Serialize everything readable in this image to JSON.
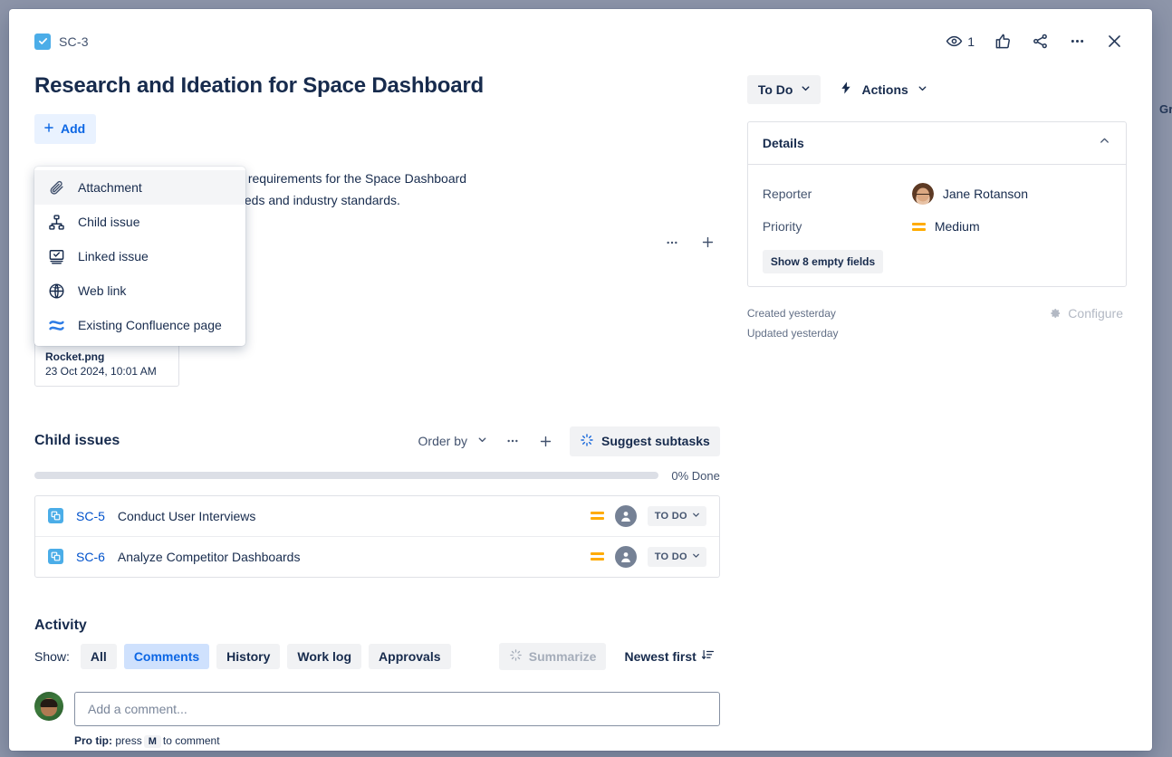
{
  "backdrop": {
    "edge_text": "Gr"
  },
  "header": {
    "issue_key": "SC-3",
    "type_icon": "task-check-icon",
    "watch_count": "1",
    "icons": [
      "eye-icon",
      "like-icon",
      "share-icon",
      "more-icon",
      "close-icon"
    ]
  },
  "issue": {
    "title": "Research and Ideation for Space Dashboard",
    "add_label": "Add",
    "description_line1": "gather inspiration and understand the requirements for the Space Dashboard",
    "description_line2": "that the wireframes align with user needs and industry standards."
  },
  "add_menu": {
    "items": [
      {
        "label": "Attachment",
        "icon": "paperclip-icon",
        "selected": true
      },
      {
        "label": "Child issue",
        "icon": "hierarchy-icon",
        "selected": false
      },
      {
        "label": "Linked issue",
        "icon": "linked-issue-icon",
        "selected": false
      },
      {
        "label": "Web link",
        "icon": "globe-icon",
        "selected": false
      },
      {
        "label": "Existing Confluence page",
        "icon": "confluence-icon",
        "selected": false
      }
    ]
  },
  "attachments": {
    "items": [
      {
        "name": "Rocket.png",
        "date": "23 Oct 2024, 10:01 AM",
        "thumb": "rocket-image"
      }
    ]
  },
  "child_issues": {
    "title": "Child issues",
    "order_by_label": "Order by",
    "suggest_label": "Suggest subtasks",
    "progress_percent": 0,
    "progress_label": "0% Done",
    "rows": [
      {
        "key": "SC-5",
        "summary": "Conduct User Interviews",
        "priority": "Medium",
        "status": "TO DO"
      },
      {
        "key": "SC-6",
        "summary": "Analyze Competitor Dashboards",
        "priority": "Medium",
        "status": "TO DO"
      }
    ]
  },
  "activity": {
    "title": "Activity",
    "show_label": "Show:",
    "filters": [
      {
        "label": "All",
        "selected": false
      },
      {
        "label": "Comments",
        "selected": true
      },
      {
        "label": "History",
        "selected": false
      },
      {
        "label": "Work log",
        "selected": false
      },
      {
        "label": "Approvals",
        "selected": false
      }
    ],
    "summarize_label": "Summarize",
    "sort_label": "Newest first",
    "comment_placeholder": "Add a comment...",
    "protip_bold": "Pro tip:",
    "protip_pre": "press",
    "protip_key": "M",
    "protip_post": "to comment"
  },
  "sidebar": {
    "status": "To Do",
    "actions_label": "Actions",
    "details_title": "Details",
    "fields": [
      {
        "label": "Reporter",
        "value": "Jane Rotanson",
        "kind": "user"
      },
      {
        "label": "Priority",
        "value": "Medium",
        "kind": "priority"
      }
    ],
    "empty_fields_label": "Show 8 empty fields",
    "created": "Created yesterday",
    "updated": "Updated yesterday",
    "configure_label": "Configure"
  },
  "colors": {
    "accent_blue": "#0c66e4",
    "link_blue": "#0052cc",
    "type_blue": "#4bade8",
    "priority_orange": "#ffab00",
    "text_dark": "#172b4d",
    "text_subtle": "#44546f"
  }
}
